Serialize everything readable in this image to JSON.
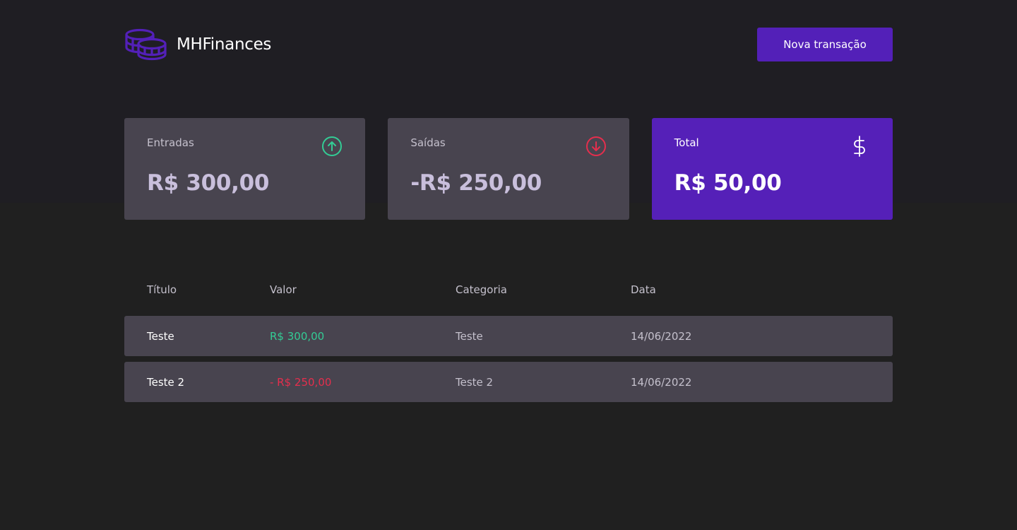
{
  "app": {
    "name": "MHFinances",
    "brand_color": "#5320b8"
  },
  "header": {
    "new_transaction_label": "Nova transação"
  },
  "summary": {
    "income": {
      "label": "Entradas",
      "value": "R$ 300,00",
      "icon": "arrow-up-circle-icon",
      "color": "#33cc95"
    },
    "outcome": {
      "label": "Saídas",
      "value": "-R$ 250,00",
      "icon": "arrow-down-circle-icon",
      "color": "#e52e4d"
    },
    "total": {
      "label": "Total",
      "value": "R$ 50,00",
      "icon": "dollar-sign-icon"
    }
  },
  "table": {
    "headers": [
      "Título",
      "Valor",
      "Categoria",
      "Data"
    ],
    "rows": [
      {
        "title": "Teste",
        "value": "R$ 300,00",
        "type": "income",
        "category": "Teste",
        "date": "14/06/2022"
      },
      {
        "title": "Teste 2",
        "value": "- R$ 250,00",
        "type": "outcome",
        "category": "Teste 2",
        "date": "14/06/2022"
      }
    ]
  }
}
